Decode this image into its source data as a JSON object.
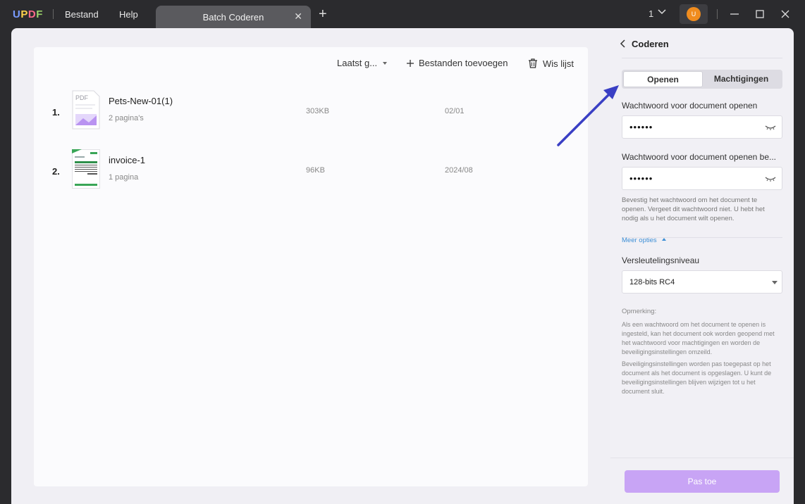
{
  "titlebar": {
    "logo": [
      "U",
      "P",
      "D",
      "F"
    ],
    "menu": [
      "Bestand",
      "Help"
    ],
    "tab_title": "Batch Coderen",
    "tab_close": "✕",
    "tab_add": "+",
    "page_count": "1",
    "avatar_initial": "U"
  },
  "toolbar": {
    "sort_label": "Laatst g...",
    "add_files_label": "Bestanden toevoegen",
    "clear_list_label": "Wis lijst"
  },
  "files": [
    {
      "num": "1.",
      "name": "Pets-New-01(1)",
      "pages": "2 pagina's",
      "size": "303KB",
      "date": "02/01",
      "thumb_label": "PDF"
    },
    {
      "num": "2.",
      "name": "invoice-1",
      "pages": "1 pagina",
      "size": "96KB",
      "date": "2024/08"
    }
  ],
  "sidebar": {
    "title": "Coderen",
    "tabs": {
      "open": "Openen",
      "permissions": "Machtigingen"
    },
    "pw_label": "Wachtwoord voor document openen",
    "pw_value": "••••••",
    "confirm_label": "Wachtwoord voor document openen be...",
    "confirm_value": "••••••",
    "hint": "Bevestig het wachtwoord om het document te openen. Vergeet dit wachtwoord niet. U hebt het nodig als u het document wilt openen.",
    "more_options": "Meer opties",
    "encryption_label": "Versleutelingsniveau",
    "encryption_value": "128-bits RC4",
    "note_title": "Opmerking:",
    "note_1": "Als een wachtwoord om het document te openen is ingesteld, kan het document ook worden geopend met het wachtwoord voor machtigingen en worden de beveiligingsinstellingen omzeild.",
    "note_2": "Beveiligingsinstellingen worden pas toegepast op het document als het document is opgeslagen. U kunt de beveiligingsinstellingen blijven wijzigen tot u het document sluit.",
    "apply_label": "Pas toe"
  },
  "colors": {
    "accent": "#c8a4f5",
    "annotation_arrow": "#3a3fc4",
    "link": "#3d8fd6"
  }
}
